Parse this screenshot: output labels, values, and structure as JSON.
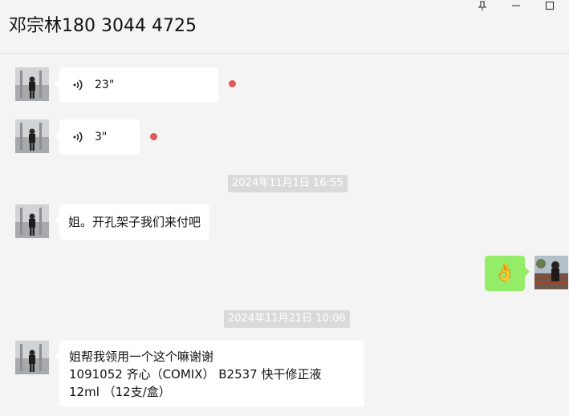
{
  "window": {
    "title": "邓宗林180 3044 4725",
    "controls": [
      {
        "name": "pin-icon"
      },
      {
        "name": "minimize-icon"
      },
      {
        "name": "maximize-icon"
      }
    ]
  },
  "messages": [
    {
      "type": "voice",
      "sender": "other",
      "duration": "23\"",
      "unread": true
    },
    {
      "type": "voice",
      "sender": "other",
      "duration": "3\"",
      "unread": true
    },
    {
      "type": "timestamp",
      "text": "2024年11月1日 16:55"
    },
    {
      "type": "text",
      "sender": "other",
      "text": "姐。开孔架子我们来付吧"
    },
    {
      "type": "emoji",
      "sender": "self",
      "emoji": "👌"
    },
    {
      "type": "timestamp",
      "text": "2024年11月21日 10:06"
    },
    {
      "type": "text",
      "sender": "other",
      "lines": [
        "姐帮我领用一个这个嘛谢谢",
        "1091052 齐心（COMIX） B2537 快干修正液",
        "12ml （12支/盒）"
      ]
    }
  ],
  "colors": {
    "background": "#f4f4f4",
    "bubble_other": "#ffffff",
    "bubble_self": "#95ec69",
    "unread_dot": "#e05a5a",
    "timestamp_bg": "#dadada"
  }
}
